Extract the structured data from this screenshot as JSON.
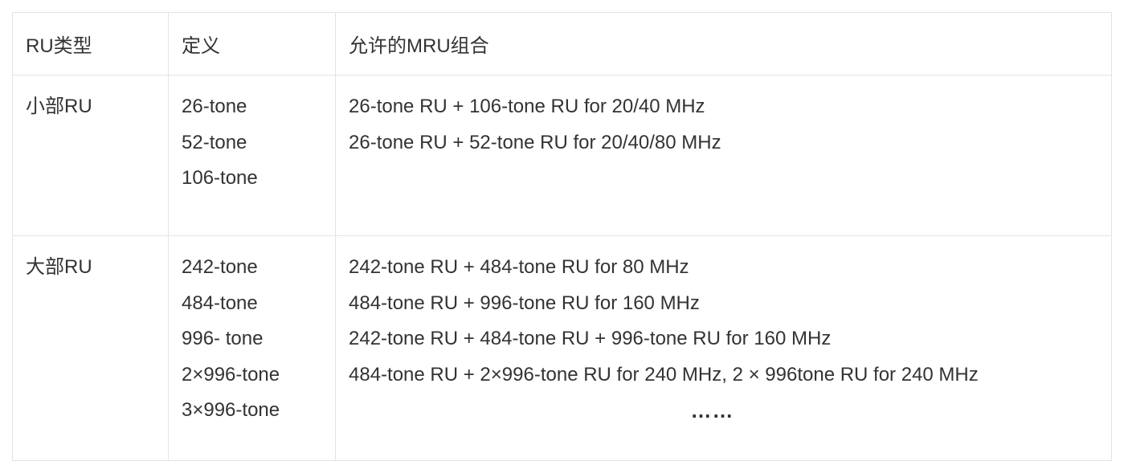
{
  "table": {
    "headers": [
      "RU类型",
      "定义",
      "允许的MRU组合"
    ],
    "rows": [
      {
        "type": "小部RU",
        "definitions": [
          "26-tone",
          "52-tone",
          "106-tone"
        ],
        "combinations": [
          "26-tone RU + 106-tone RU for 20/40 MHz",
          "26-tone RU + 52-tone RU for 20/40/80 MHz"
        ]
      },
      {
        "type": "大部RU",
        "definitions": [
          "242-tone",
          "484-tone",
          "996- tone",
          "2×996-tone",
          "3×996-tone"
        ],
        "combinations": [
          "242-tone RU + 484-tone RU for 80 MHz",
          "484-tone RU + 996-tone RU for 160 MHz",
          "242-tone RU + 484-tone RU + 996-tone RU for 160 MHz",
          "484-tone RU + 2×996-tone RU for 240 MHz, 2 × 996tone RU for 240 MHz"
        ],
        "ellipsis": "……"
      }
    ]
  }
}
